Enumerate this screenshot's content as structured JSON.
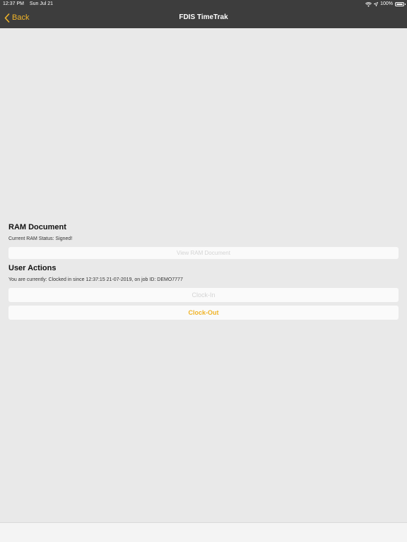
{
  "status_bar": {
    "time": "12:37 PM",
    "date": "Sun Jul 21",
    "battery": "100%",
    "battery_level": 1.0
  },
  "nav": {
    "back_label": "Back",
    "title": "FDIS TimeTrak"
  },
  "ram_document": {
    "title": "RAM Document",
    "status": "Current RAM Status: Signed!",
    "view_button": "View RAM Document"
  },
  "user_actions": {
    "title": "User Actions",
    "status": "You are currently: Clocked in since 12:37:15 21-07-2019, on job ID: DEMO7777",
    "clock_in_button": "Clock-In",
    "clock_out_button": "Clock-Out"
  },
  "colors": {
    "accent": "#f0b429",
    "nav_background": "#3d3d3d",
    "page_background": "#e9e9e9",
    "disabled_text": "#d4d4d4"
  }
}
